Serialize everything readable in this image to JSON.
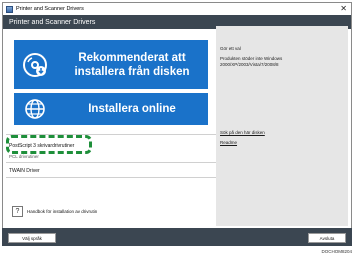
{
  "window": {
    "title": "Printer and Scanner Drivers",
    "close_glyph": "✕"
  },
  "header": {
    "title": "Printer and Scanner Drivers"
  },
  "main": {
    "install_disk_label": "Rekommenderat att installera från disken",
    "install_online_label": "Installera online",
    "items": [
      {
        "label": "PostScript 3 skrivardrivrutiner"
      },
      {
        "label": "PCL drivrutiner"
      },
      {
        "label": "TWAIN Driver"
      }
    ],
    "help_label": "Handbok för installation av drivrutin"
  },
  "right": {
    "heading": "Gör ett val",
    "description": "Produkten stöder inte Windows 2000/XP/2003/Vista/7/2008/8",
    "link1": "Sök på den här disken",
    "link2": "Readme"
  },
  "footer": {
    "language_button": "Välj språk",
    "exit_button": "Avsluta"
  },
  "figure_code": "DOCHOM8204",
  "colors": {
    "header_bg": "#3b4651",
    "button_bg": "#1a72c9",
    "highlight": "#1e8f3a"
  },
  "icons": {
    "disk": "disc-install-icon",
    "online": "globe-icon",
    "help": "question-icon"
  }
}
